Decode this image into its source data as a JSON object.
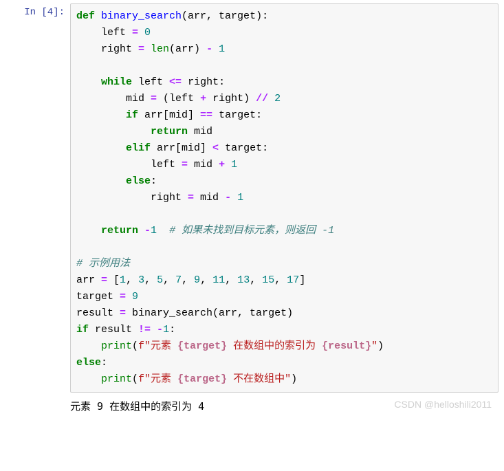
{
  "prompt": "In  [4]:",
  "code_tokens": [
    [
      [
        "def ",
        "kw"
      ],
      [
        "binary_search",
        "fn"
      ],
      [
        "(arr, target):",
        "pu"
      ]
    ],
    [
      [
        "    left ",
        ""
      ],
      [
        "= ",
        "op"
      ],
      [
        "0",
        "num"
      ]
    ],
    [
      [
        "    right ",
        ""
      ],
      [
        "= ",
        "op"
      ],
      [
        "len",
        "bi"
      ],
      [
        "(arr) ",
        "pu"
      ],
      [
        "- ",
        "op"
      ],
      [
        "1",
        "num"
      ]
    ],
    [],
    [
      [
        "    ",
        ""
      ],
      [
        "while ",
        "kw"
      ],
      [
        "left ",
        ""
      ],
      [
        "<= ",
        "op"
      ],
      [
        "right:",
        ""
      ]
    ],
    [
      [
        "        mid ",
        ""
      ],
      [
        "= ",
        "op"
      ],
      [
        "(left ",
        ""
      ],
      [
        "+ ",
        "op"
      ],
      [
        "right) ",
        ""
      ],
      [
        "// ",
        "op"
      ],
      [
        "2",
        "num"
      ]
    ],
    [
      [
        "        ",
        ""
      ],
      [
        "if ",
        "kw"
      ],
      [
        "arr[mid] ",
        ""
      ],
      [
        "== ",
        "op"
      ],
      [
        "target:",
        ""
      ]
    ],
    [
      [
        "            ",
        ""
      ],
      [
        "return ",
        "kw"
      ],
      [
        "mid",
        ""
      ]
    ],
    [
      [
        "        ",
        ""
      ],
      [
        "elif ",
        "kw"
      ],
      [
        "arr[mid] ",
        ""
      ],
      [
        "< ",
        "op"
      ],
      [
        "target:",
        ""
      ]
    ],
    [
      [
        "            left ",
        ""
      ],
      [
        "= ",
        "op"
      ],
      [
        "mid ",
        ""
      ],
      [
        "+ ",
        "op"
      ],
      [
        "1",
        "num"
      ]
    ],
    [
      [
        "        ",
        ""
      ],
      [
        "else",
        "kw"
      ],
      [
        ":",
        ""
      ]
    ],
    [
      [
        "            right ",
        ""
      ],
      [
        "= ",
        "op"
      ],
      [
        "mid ",
        ""
      ],
      [
        "- ",
        "op"
      ],
      [
        "1",
        "num"
      ]
    ],
    [],
    [
      [
        "    ",
        ""
      ],
      [
        "return ",
        "kw"
      ],
      [
        "-",
        "op"
      ],
      [
        "1",
        "num"
      ],
      [
        "  ",
        ""
      ],
      [
        "# 如果未找到目标元素，则返回 -1",
        "cm"
      ]
    ],
    [],
    [
      [
        "# 示例用法",
        "cm"
      ]
    ],
    [
      [
        "arr ",
        ""
      ],
      [
        "= ",
        "op"
      ],
      [
        "[",
        ""
      ],
      [
        "1",
        "num"
      ],
      [
        ", ",
        ""
      ],
      [
        "3",
        "num"
      ],
      [
        ", ",
        ""
      ],
      [
        "5",
        "num"
      ],
      [
        ", ",
        ""
      ],
      [
        "7",
        "num"
      ],
      [
        ", ",
        ""
      ],
      [
        "9",
        "num"
      ],
      [
        ", ",
        ""
      ],
      [
        "11",
        "num"
      ],
      [
        ", ",
        ""
      ],
      [
        "13",
        "num"
      ],
      [
        ", ",
        ""
      ],
      [
        "15",
        "num"
      ],
      [
        ", ",
        ""
      ],
      [
        "17",
        "num"
      ],
      [
        "]",
        ""
      ]
    ],
    [
      [
        "target ",
        ""
      ],
      [
        "= ",
        "op"
      ],
      [
        "9",
        "num"
      ]
    ],
    [
      [
        "result ",
        ""
      ],
      [
        "= ",
        "op"
      ],
      [
        "binary_search(arr, target)",
        ""
      ]
    ],
    [
      [
        "if ",
        "kw"
      ],
      [
        "result ",
        ""
      ],
      [
        "!= ",
        "op"
      ],
      [
        "-",
        "op"
      ],
      [
        "1",
        "num"
      ],
      [
        ":",
        ""
      ]
    ],
    [
      [
        "    ",
        ""
      ],
      [
        "print",
        "bi"
      ],
      [
        "(",
        ""
      ],
      [
        "f\"元素 ",
        "str"
      ],
      [
        "{target}",
        "si"
      ],
      [
        " 在数组中的索引为 ",
        "str"
      ],
      [
        "{result}",
        "si"
      ],
      [
        "\"",
        "str"
      ],
      [
        ")",
        ""
      ]
    ],
    [
      [
        "else",
        "kw"
      ],
      [
        ":",
        ""
      ]
    ],
    [
      [
        "    ",
        ""
      ],
      [
        "print",
        "bi"
      ],
      [
        "(",
        ""
      ],
      [
        "f\"元素 ",
        "str"
      ],
      [
        "{target}",
        "si"
      ],
      [
        " 不在数组中\"",
        "str"
      ],
      [
        ")",
        ""
      ]
    ]
  ],
  "output": "元素 9 在数组中的索引为 4",
  "watermark": "CSDN @helloshili2011"
}
